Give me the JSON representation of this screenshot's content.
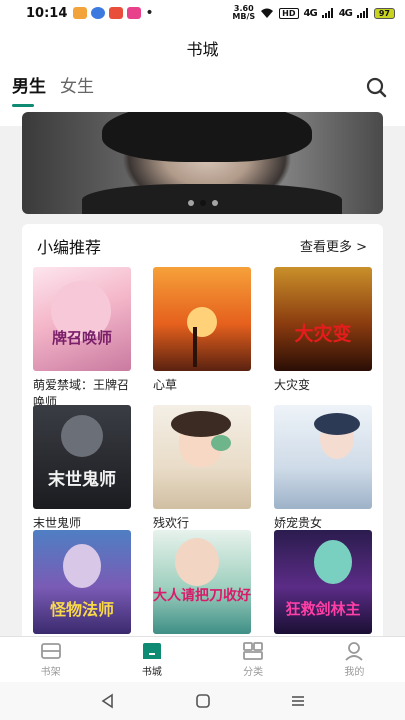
{
  "status_bar": {
    "time": "10:14",
    "dot": "•",
    "speed_value": "3.60",
    "speed_unit": "MB/S",
    "hd": "HD",
    "signal1": "4G",
    "signal2": "4G",
    "battery": "97"
  },
  "header": {
    "title": "书城"
  },
  "gender_tabs": [
    {
      "label": "男生",
      "active": true
    },
    {
      "label": "女生",
      "active": false
    }
  ],
  "section": {
    "title": "小编推荐",
    "more_label": "查看更多 >"
  },
  "books": [
    {
      "title": "萌爱禁域：王牌召唤师",
      "cover_text": "牌召唤师"
    },
    {
      "title": "心草",
      "cover_text": ""
    },
    {
      "title": "大灾变",
      "cover_text": "大灾变"
    },
    {
      "title": "末世鬼师",
      "cover_text": "末世鬼师"
    },
    {
      "title": "残欢行",
      "cover_text": ""
    },
    {
      "title": "娇宠贵女",
      "cover_text": ""
    },
    {
      "title": "",
      "cover_text": "怪物法师"
    },
    {
      "title": "",
      "cover_text": "大人请把刀收好"
    },
    {
      "title": "",
      "cover_text": "狂救剑林主"
    }
  ],
  "bottom_nav": [
    {
      "label": "书架",
      "icon": "bookshelf-icon"
    },
    {
      "label": "书城",
      "icon": "bookstore-icon",
      "active": true
    },
    {
      "label": "分类",
      "icon": "category-icon"
    },
    {
      "label": "我的",
      "icon": "profile-icon"
    }
  ],
  "colors": {
    "accent": "#0f8a73"
  }
}
